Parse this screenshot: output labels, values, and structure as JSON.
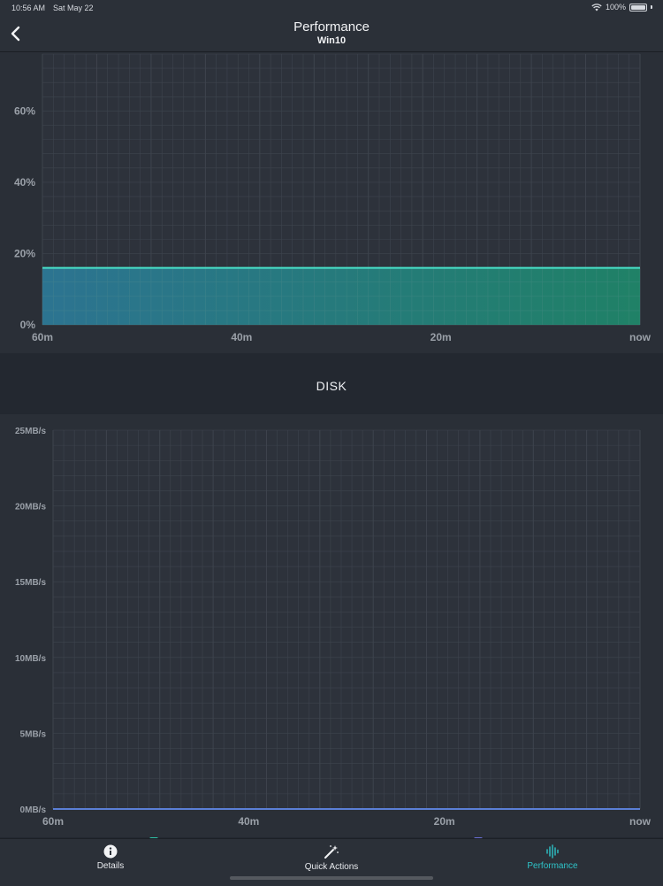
{
  "status_bar": {
    "time": "10:56 AM",
    "date": "Sat May 22",
    "battery": "100%"
  },
  "nav": {
    "title": "Performance",
    "subtitle": "Win10"
  },
  "charts": {
    "cpu": {
      "type": "area",
      "x_ticks": [
        "60m",
        "40m",
        "20m",
        "now"
      ],
      "y_ticks": [
        "0%",
        "20%",
        "40%",
        "60%"
      ],
      "ylim": [
        0,
        76
      ],
      "value": 16,
      "colors": {
        "fill_start": "#2c7fa0",
        "fill_end": "#1d8f6e",
        "line": "#48e0c8"
      }
    },
    "disk": {
      "title": "DISK",
      "type": "line",
      "x_ticks": [
        "60m",
        "40m",
        "20m",
        "now"
      ],
      "y_ticks": [
        "0MB/s",
        "5MB/s",
        "10MB/s",
        "15MB/s",
        "20MB/s",
        "25MB/s"
      ],
      "ylim": [
        0,
        25
      ],
      "value": 0,
      "colors": {
        "line": "#5b7fd6"
      }
    }
  },
  "chart_data": [
    {
      "type": "area",
      "x": [
        "60m",
        "40m",
        "20m",
        "now"
      ],
      "series": [
        {
          "values": [
            16,
            16,
            16,
            16
          ]
        }
      ],
      "ylim": [
        0,
        76
      ],
      "y_tick_labels": [
        "0%",
        "20%",
        "40%",
        "60%"
      ],
      "grid": true
    },
    {
      "type": "line",
      "title": "DISK",
      "x": [
        "60m",
        "40m",
        "20m",
        "now"
      ],
      "series": [
        {
          "values": [
            0,
            0,
            0,
            0
          ]
        }
      ],
      "ylim": [
        0,
        25
      ],
      "y_tick_labels": [
        "0MB/s",
        "5MB/s",
        "10MB/s",
        "15MB/s",
        "20MB/s",
        "25MB/s"
      ],
      "grid": true
    }
  ],
  "legend_colors": {
    "read": "#2ec4a9",
    "write": "#6a6fd8"
  },
  "tabs": [
    {
      "label": "Details",
      "icon": "info-icon"
    },
    {
      "label": "Quick Actions",
      "icon": "magic-wand-icon"
    },
    {
      "label": "Performance",
      "icon": "waveform-icon",
      "active": true
    }
  ]
}
